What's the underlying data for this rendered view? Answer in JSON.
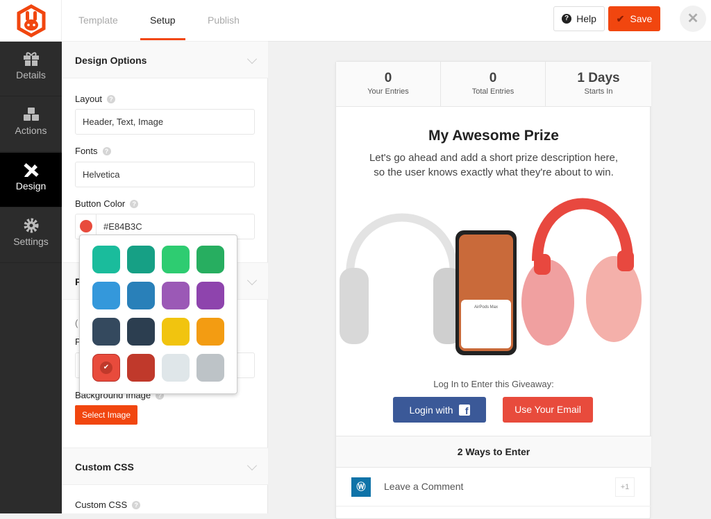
{
  "tabs": [
    {
      "label": "Template"
    },
    {
      "label": "Setup",
      "active": true
    },
    {
      "label": "Publish"
    }
  ],
  "header": {
    "help_label": "Help",
    "save_label": "Save"
  },
  "sidenav": [
    {
      "label": "Details",
      "icon": "gift-icon"
    },
    {
      "label": "Actions",
      "icon": "cubes-icon"
    },
    {
      "label": "Design",
      "icon": "design-tools-icon",
      "active": true
    },
    {
      "label": "Settings",
      "icon": "gear-icon"
    }
  ],
  "panel": {
    "design_options": "Design Options",
    "layout_label": "Layout",
    "layout_value": "Header, Text, Image",
    "fonts_label": "Fonts",
    "fonts_value": "Helvetica",
    "button_color_label": "Button Color",
    "button_color_value": "#E84B3C",
    "hidden_section_stub": "P",
    "hidden_text_stub": "(",
    "hidden_label_stub": "P",
    "background_image_label": "Background Image",
    "select_image": "Select Image",
    "custom_css_section": "Custom CSS",
    "custom_css_label": "Custom CSS"
  },
  "swatches": [
    "#1abc9c",
    "#16a085",
    "#2ecc71",
    "#27ae60",
    "#3498db",
    "#2980b9",
    "#9b59b6",
    "#8e44ad",
    "#34495e",
    "#2c3e50",
    "#f1c40f",
    "#f39c12",
    "#e84b3c",
    "#c0392b",
    "#dfe6e9",
    "#bdc3c7"
  ],
  "selected_swatch": "#e84b3c",
  "preview": {
    "stats": [
      {
        "value": "0",
        "label": "Your Entries"
      },
      {
        "value": "0",
        "label": "Total Entries"
      },
      {
        "value": "1 Days",
        "label": "Starts In"
      }
    ],
    "title": "My Awesome Prize",
    "desc1": "Let's go ahead and add a short prize description here,",
    "desc2": "so the user knows exactly what they're about to win.",
    "phone_caption": "AirPods Max",
    "login_prompt": "Log In to Enter this Giveaway:",
    "fb_label": "Login with",
    "email_label": "Use Your Email",
    "ways_title": "2 Ways to Enter",
    "entry": {
      "label": "Leave a Comment",
      "points": "+1"
    }
  },
  "colors": {
    "accent": "#f1460f",
    "facebook": "#3b5998",
    "button": "#e84b3c"
  }
}
